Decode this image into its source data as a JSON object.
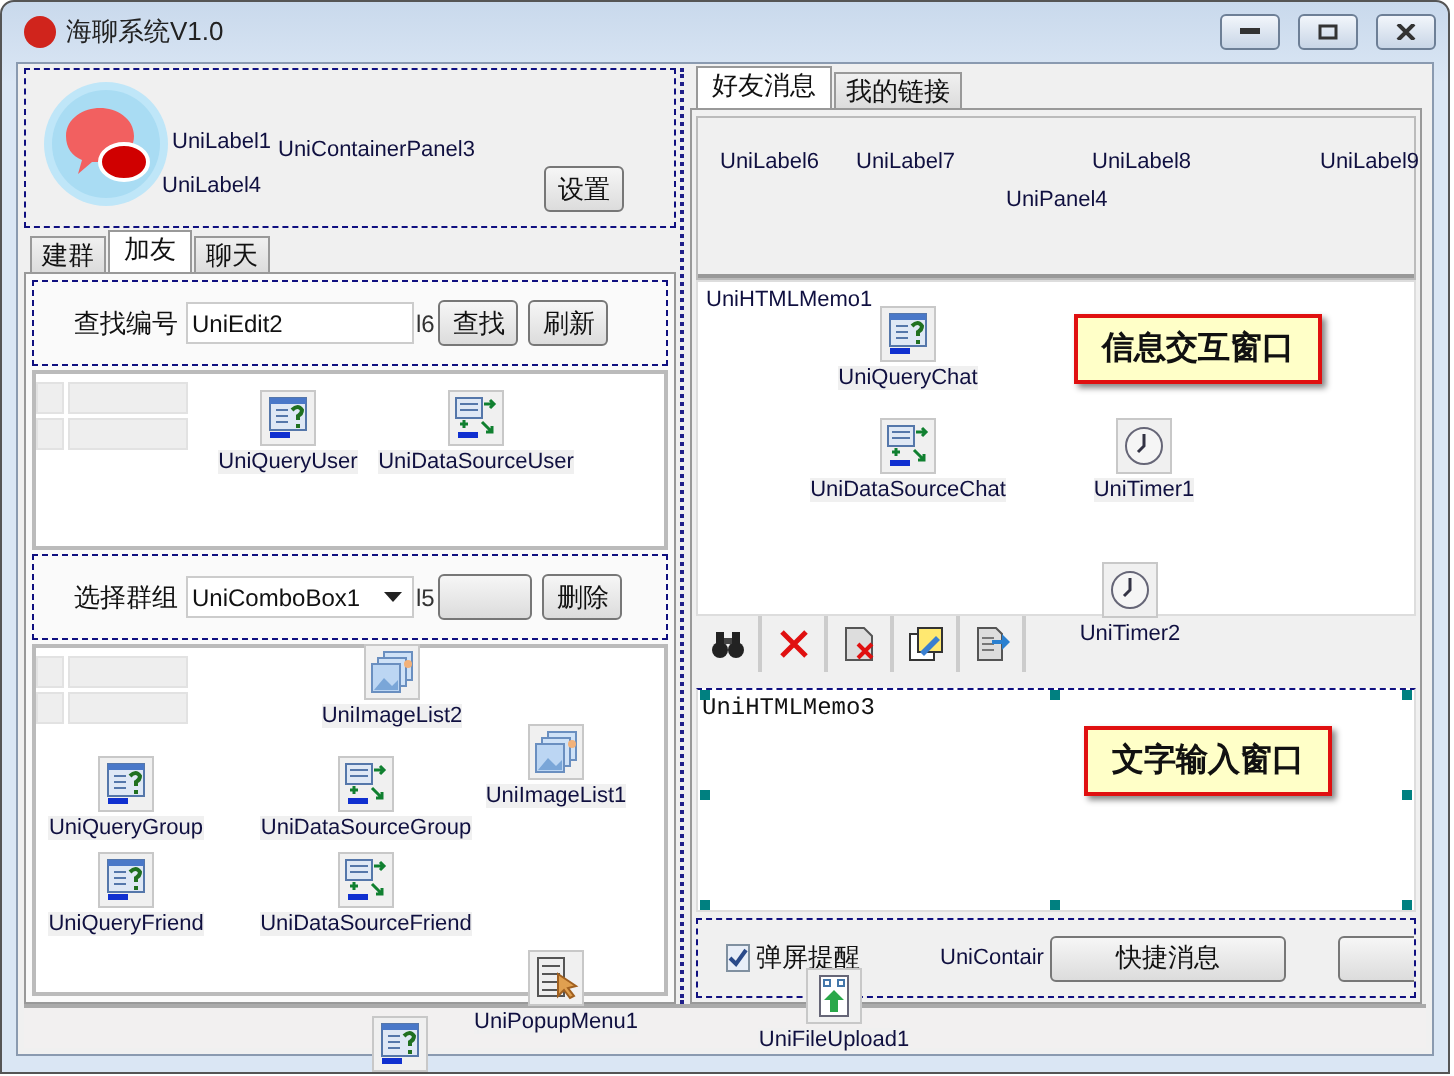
{
  "window": {
    "title": "海聊系统V1.0"
  },
  "header_panel": {
    "labels": [
      "UniLabel1",
      "UniContainerPanel3",
      "UniLabel4"
    ],
    "button": "设置"
  },
  "left_tabs": [
    {
      "label": "建群",
      "selected": false
    },
    {
      "label": "加友",
      "selected": true
    },
    {
      "label": "聊天",
      "selected": false
    }
  ],
  "search_row": {
    "label": "查找编号",
    "value": "UniEdit2",
    "hidden_label": "l6",
    "buttons": [
      "查找",
      "刷新"
    ]
  },
  "user_components": [
    {
      "kind": "query",
      "name": "UniQueryUser"
    },
    {
      "kind": "datasource",
      "name": "UniDataSourceUser"
    }
  ],
  "group_row": {
    "label": "选择群组",
    "value": "UniComboBox1",
    "hidden_label": "l5",
    "button": "删除",
    "components": [
      {
        "kind": "imagelist",
        "name": "UniImageList2"
      }
    ]
  },
  "group_components": [
    {
      "kind": "query",
      "name": "UniQueryGroup"
    },
    {
      "kind": "datasource",
      "name": "UniDataSourceGroup"
    },
    {
      "kind": "imagelist",
      "name": "UniImageList1"
    },
    {
      "kind": "query",
      "name": "UniQueryFriend"
    },
    {
      "kind": "datasource",
      "name": "UniDataSourceFriend"
    },
    {
      "kind": "popupmenu",
      "name": "UniPopupMenu1"
    }
  ],
  "right_tabs": [
    {
      "label": "好友消息",
      "selected": true
    },
    {
      "label": "我的链接",
      "selected": false
    }
  ],
  "top_panel": {
    "labels": [
      "UniLabel6",
      "UniLabel7",
      "UniLabel8",
      "UniLabel9"
    ],
    "caption": "UniPanel4"
  },
  "chat_memo": {
    "caption": "UniHTMLMemo1",
    "callout": "信息交互窗口",
    "components": [
      {
        "kind": "query",
        "name": "UniQueryChat"
      },
      {
        "kind": "datasource",
        "name": "UniDataSourceChat"
      },
      {
        "kind": "timer",
        "name": "UniTimer1"
      },
      {
        "kind": "timer",
        "name": "UniTimer2"
      }
    ]
  },
  "toolbar": [
    {
      "kind": "find"
    },
    {
      "kind": "cancel"
    },
    {
      "kind": "delete"
    },
    {
      "kind": "edit"
    },
    {
      "kind": "export"
    }
  ],
  "input_memo": {
    "text": "UniHTMLMemo3",
    "callout": "文字输入窗口"
  },
  "bottom_panel": {
    "checkbox": {
      "label": "弹屏提醒",
      "checked": true
    },
    "caption": "UniContair",
    "button": "快捷消息"
  },
  "form_components": [
    {
      "kind": "fileupload",
      "name": "UniFileUpload1"
    },
    {
      "kind": "query"
    }
  ]
}
